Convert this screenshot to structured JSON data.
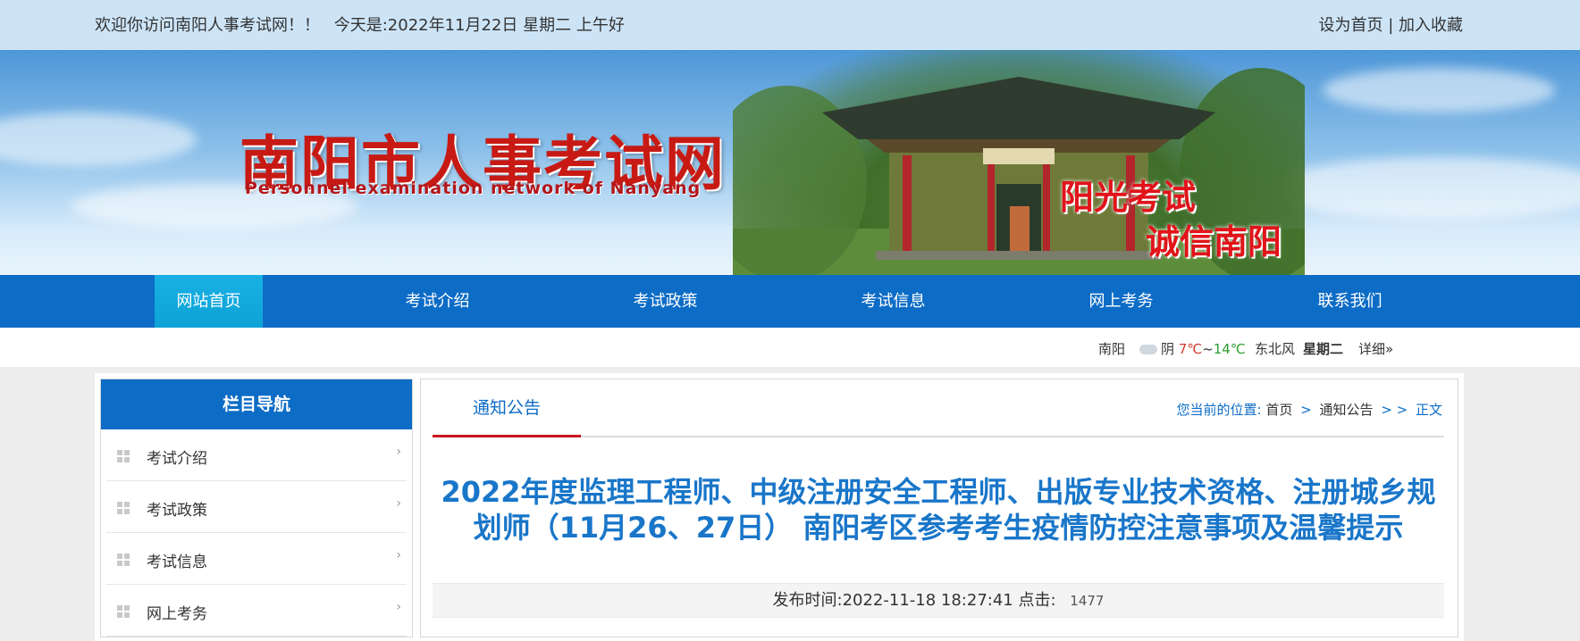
{
  "topbar": {
    "welcome": "欢迎你访问南阳人事考试网！！",
    "today": "今天是:2022年11月22日 星期二 上午好",
    "set_home": "设为首页",
    "divider": "|",
    "add_fav": "加入收藏"
  },
  "banner": {
    "title": "南阳市人事考试网",
    "subtitle": "Personnel examination network of Nanyang",
    "slogan_line1": "阳光考试",
    "slogan_line2": "诚信南阳"
  },
  "nav": {
    "items": [
      {
        "label": "网站首页",
        "active": true
      },
      {
        "label": "考试介绍"
      },
      {
        "label": "考试政策"
      },
      {
        "label": "考试信息"
      },
      {
        "label": "网上考务"
      },
      {
        "label": "联系我们"
      }
    ]
  },
  "weather": {
    "city": "南阳",
    "condition": "阴",
    "low": "7℃",
    "range_sep": "~",
    "high": "14℃",
    "wind": "东北风",
    "weekday": "星期二",
    "detail": "详细»"
  },
  "sidebar": {
    "title": "栏目导航",
    "items": [
      {
        "label": "考试介绍"
      },
      {
        "label": "考试政策"
      },
      {
        "label": "考试信息"
      },
      {
        "label": "网上考务"
      }
    ]
  },
  "content": {
    "tab": "通知公告",
    "breadcrumb": {
      "prefix": "您当前的位置:",
      "home": "首页",
      "sep": ">",
      "section": "通知公告",
      "extra_sep": "> >",
      "current": "正文"
    },
    "title": "2022年度监理工程师、中级注册安全工程师、出版专业技术资格、注册城乡规划师（11月26、27日） 南阳考区参考考生疫情防控注意事项及温馨提示",
    "published": "发布时间:2022-11-18 18:27:41",
    "clicks_label": "点击:",
    "clicks": "1477"
  },
  "colors": {
    "nav_blue": "#0d6cc6",
    "nav_active": "#12a8dc",
    "title_red": "#c81a14",
    "article_blue": "#1976c9"
  }
}
